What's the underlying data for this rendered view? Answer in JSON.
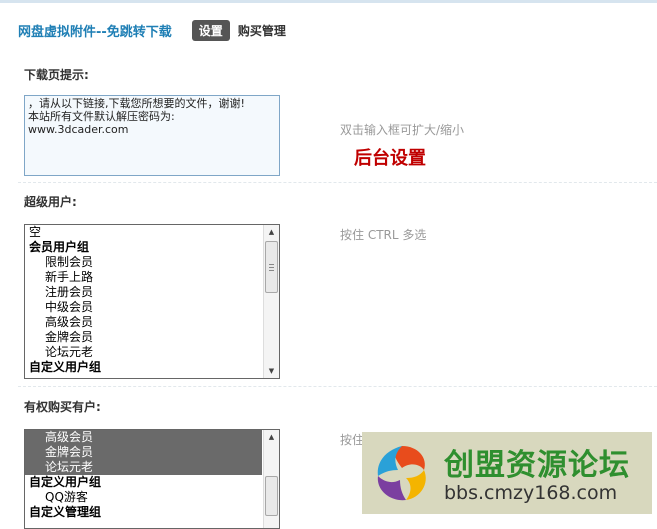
{
  "header": {
    "plugin_title": "网盘虚拟附件--免跳转下载",
    "tabs": [
      {
        "label": "设置",
        "active": true
      },
      {
        "label": "购买管理",
        "active": false
      }
    ]
  },
  "download_tip": {
    "label": "下载页提示:",
    "value": "，请从以下链接,下载您所想要的文件，谢谢!\n本站所有文件默认解压密码为:\nwww.3dcader.com",
    "hint": "双击输入框可扩大/缩小"
  },
  "annotation": "后台设置",
  "super_users": {
    "label": "超级用户:",
    "hint": "按住 CTRL 多选",
    "options": [
      {
        "text": "空",
        "kind": "plain",
        "selected": false
      },
      {
        "text": "会员用户组",
        "kind": "group",
        "selected": false
      },
      {
        "text": "限制会员",
        "kind": "item",
        "selected": false
      },
      {
        "text": "新手上路",
        "kind": "item",
        "selected": false
      },
      {
        "text": "注册会员",
        "kind": "item",
        "selected": false
      },
      {
        "text": "中级会员",
        "kind": "item",
        "selected": false
      },
      {
        "text": "高级会员",
        "kind": "item",
        "selected": false
      },
      {
        "text": "金牌会员",
        "kind": "item",
        "selected": false
      },
      {
        "text": "论坛元老",
        "kind": "item",
        "selected": false
      },
      {
        "text": "自定义用户组",
        "kind": "group",
        "selected": false
      }
    ]
  },
  "buyers": {
    "label": "有权购买有户:",
    "hint": "按住",
    "options": [
      {
        "text": "高级会员",
        "kind": "item",
        "selected": true
      },
      {
        "text": "金牌会员",
        "kind": "item",
        "selected": true
      },
      {
        "text": "论坛元老",
        "kind": "item",
        "selected": true
      },
      {
        "text": "自定义用户组",
        "kind": "group",
        "selected": false
      },
      {
        "text": "QQ游客",
        "kind": "item",
        "selected": false
      },
      {
        "text": "自定义管理组",
        "kind": "group",
        "selected": false
      }
    ]
  },
  "watermark": {
    "title": "创盟资源论坛",
    "url": "bbs.cmzy168.com"
  },
  "colors": {
    "title_blue": "#1f7fb5",
    "annotation_red": "#c00000",
    "selected_option": "#6a6a6a",
    "watermark_green": "#2f8f2f"
  }
}
